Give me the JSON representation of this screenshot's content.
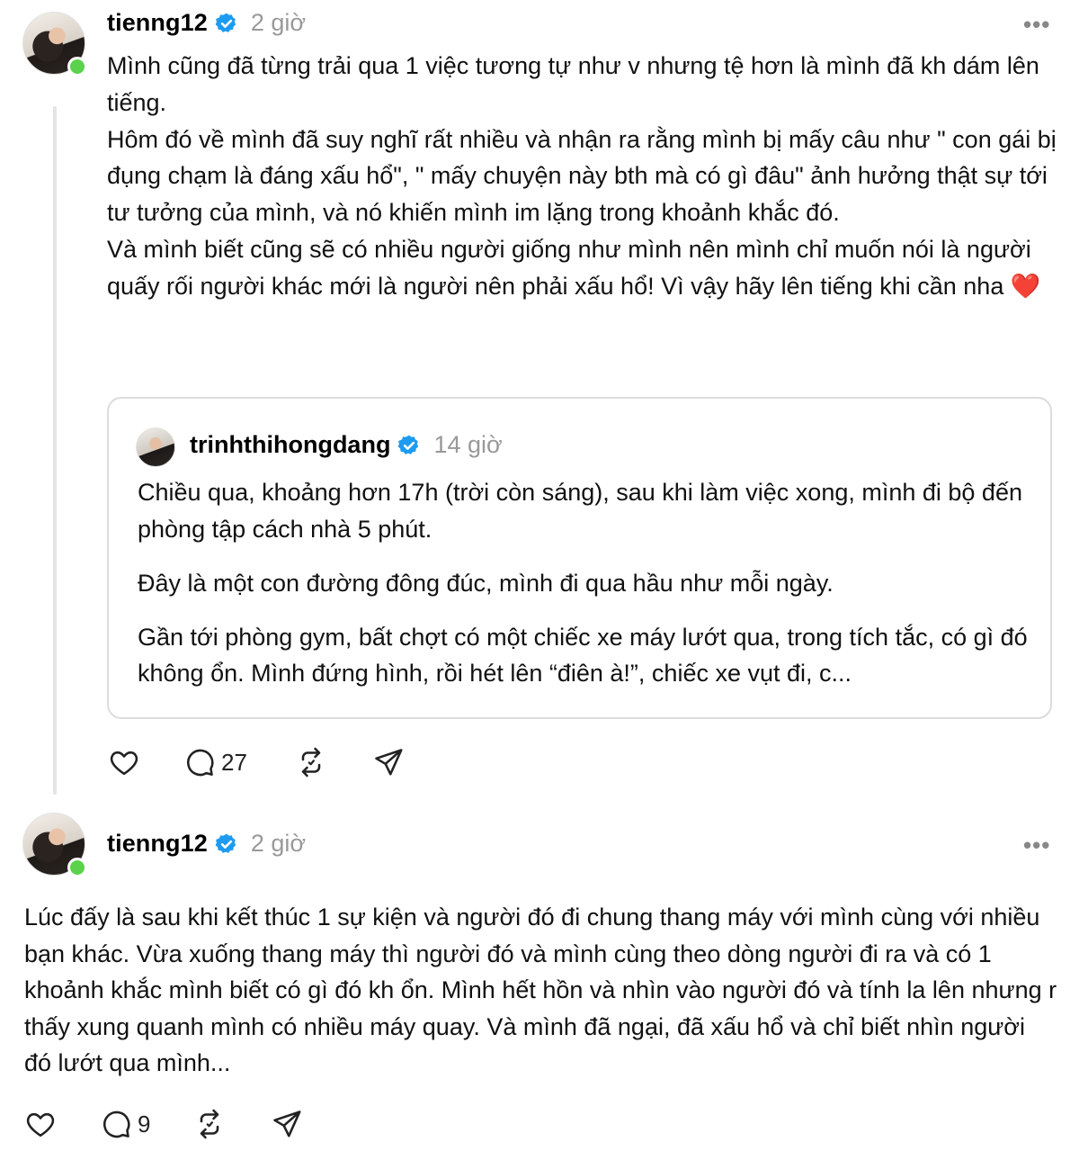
{
  "posts": [
    {
      "username": "tienng12",
      "time": "2 giờ",
      "more_label": "•••",
      "body": {
        "line1": "Mình cũng đã từng trải qua 1 việc tương tự như v nhưng tệ hơn là mình đã kh dám lên tiếng.",
        "line2": "Hôm đó về mình đã suy nghĩ rất nhiều và nhận ra rằng mình bị mấy câu như \" con gái bị đụng chạm là đáng xấu hổ\", \" mấy chuyện này bth mà có gì đâu\" ảnh hưởng thật sự tới tư tưởng của mình, và nó khiến mình im lặng trong khoảnh khắc đó.",
        "line3": "Và mình biết cũng sẽ có nhiều người giống như mình nên mình chỉ muốn nói là người quấy rối người khác mới là người nên phải xấu hổ! Vì vậy hãy lên tiếng khi cần nha",
        "emoji": "❤️"
      },
      "quote": {
        "username": "trinhthihongdang",
        "time": "14 giờ",
        "paragraphs": [
          "Chiều qua, khoảng hơn 17h (trời còn sáng), sau khi làm việc xong, mình đi bộ đến phòng tập cách nhà 5 phút.",
          "Đây là một con đường đông đúc, mình đi qua hầu như mỗi ngày.",
          "Gần tới phòng gym, bất chợt có một chiếc xe máy lướt qua, trong tích tắc, có gì đó không ổn. Mình đứng hình, rồi hét lên “điên à!”, chiếc xe vụt đi, c..."
        ]
      },
      "actions": {
        "reply_count": "27"
      }
    },
    {
      "username": "tienng12",
      "time": "2 giờ",
      "more_label": "•••",
      "body": {
        "text": "Lúc đấy là sau khi kết thúc 1 sự kiện và người đó đi chung thang máy với mình cùng với nhiều bạn khác. Vừa xuống thang máy thì người đó và mình cùng theo dòng người đi ra và có 1 khoảnh khắc mình biết có gì đó kh ổn. Mình hết hồn và nhìn vào người đó và tính la lên nhưng r thấy xung quanh mình có nhiều máy quay. Và mình đã ngại, đã xấu hổ và chỉ biết nhìn người đó lướt qua mình..."
      },
      "actions": {
        "reply_count": "9"
      }
    }
  ],
  "colors": {
    "verified": "#1d9bf0",
    "online": "#5ad24b",
    "muted": "#999999",
    "border": "#dcdcdc"
  },
  "icons": [
    "heart-icon",
    "comment-icon",
    "repost-icon",
    "share-icon",
    "verified-icon",
    "more-icon"
  ]
}
